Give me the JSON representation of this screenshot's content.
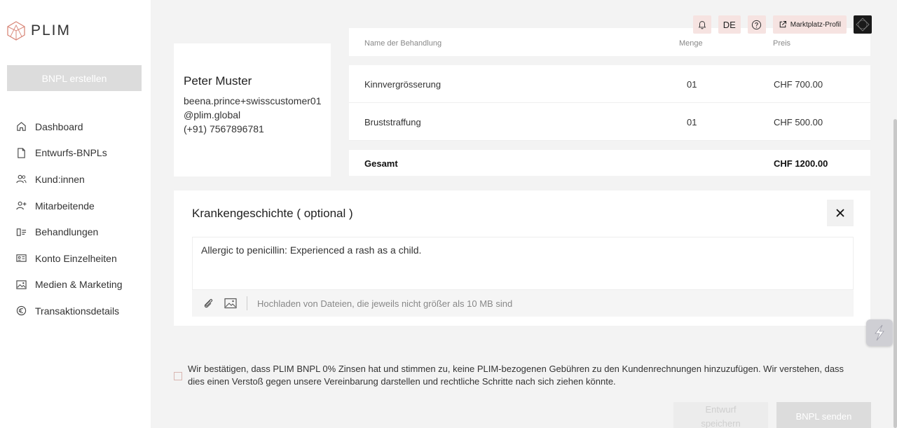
{
  "brand": {
    "name": "PLIM"
  },
  "sidebar": {
    "create_button": "BNPL erstellen",
    "items": [
      {
        "label": "Dashboard",
        "icon": "home-icon"
      },
      {
        "label": "Entwurfs-BNPLs",
        "icon": "file-icon"
      },
      {
        "label": "Kund:innen",
        "icon": "users-icon"
      },
      {
        "label": "Mitarbeitende",
        "icon": "user-plus-icon"
      },
      {
        "label": "Behandlungen",
        "icon": "treatment-icon"
      },
      {
        "label": "Konto Einzelheiten",
        "icon": "id-card-icon"
      },
      {
        "label": "Medien & Marketing",
        "icon": "image-icon"
      },
      {
        "label": "Transaktionsdetails",
        "icon": "euro-icon"
      }
    ]
  },
  "topbar": {
    "language": "DE",
    "marketplace": "Marktplatz-Profil"
  },
  "customer": {
    "name": "Peter Muster",
    "email": "beena.prince+swisscustomer01@plim.global",
    "phone": "(+91) 7567896781"
  },
  "treatments": {
    "headers": {
      "name": "Name der Behandlung",
      "qty": "Menge",
      "price": "Preis"
    },
    "rows": [
      {
        "name": "Kinnvergrösserung",
        "qty": "01",
        "price": "CHF 700.00"
      },
      {
        "name": "Bruststraffung",
        "qty": "01",
        "price": "CHF 500.00"
      }
    ],
    "total_label": "Gesamt",
    "total_value": "CHF 1200.00"
  },
  "history": {
    "title": "Krankengeschichte ( optional )",
    "text": "Allergic to penicillin: Experienced a rash as a child.",
    "upload_hint": "Hochladen von Dateien, die jeweils nicht größer als 10 MB sind"
  },
  "consent": {
    "text": "Wir bestätigen, dass PLIM BNPL 0% Zinsen hat und stimmen zu, keine PLIM-bezogenen Gebühren zu den Kundenrechnungen hinzuzufügen. Wir verstehen, dass dies einen Verstoß gegen unsere Vereinbarung darstellen und rechtliche Schritte nach sich ziehen könnte."
  },
  "actions": {
    "draft": "Entwurf speichern",
    "send": "BNPL senden"
  },
  "colors": {
    "accent": "#d9887a",
    "accent_light": "#f6e3e1"
  }
}
